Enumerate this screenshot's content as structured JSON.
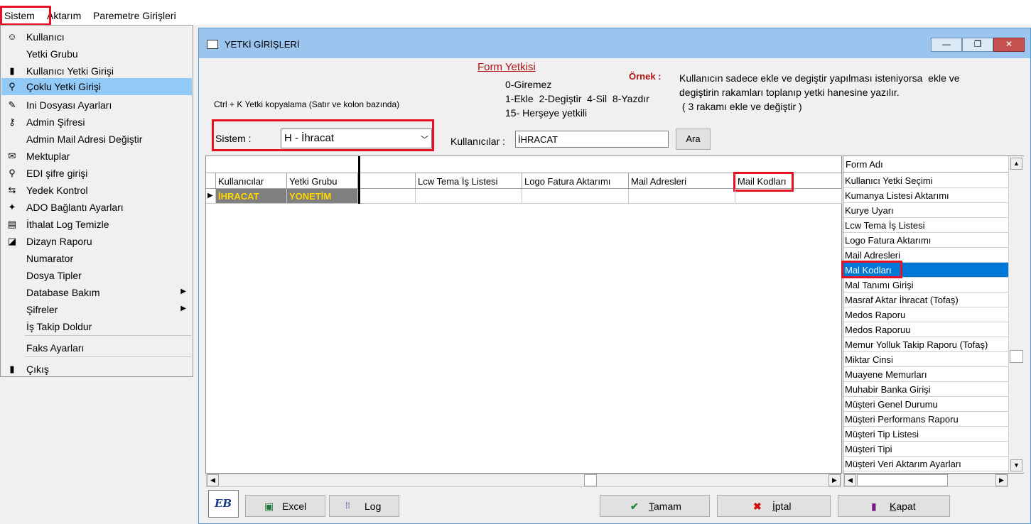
{
  "app": {
    "title_fragment": ""
  },
  "menubar": {
    "items": [
      "Sistem",
      "Aktarım",
      "Paremetre Girişleri"
    ]
  },
  "menu": {
    "items": [
      {
        "label": "Kullanıcı",
        "icon": "user-icon",
        "glyph": "☺"
      },
      {
        "label": "Yetki Grubu",
        "icon": "",
        "glyph": ""
      },
      {
        "label": "Kullanıcı Yetki Girişi",
        "icon": "bottle-icon",
        "glyph": "▮"
      },
      {
        "label": "Çoklu Yetki Girişi",
        "icon": "key-flag-icon",
        "glyph": "⚲"
      },
      {
        "label": "Ini Dosyası  Ayarları",
        "icon": "edit-icon",
        "glyph": "✎"
      },
      {
        "label": "Admin Şifresi",
        "icon": "key-icon",
        "glyph": "⚷"
      },
      {
        "label": "Admin Mail Adresi Değiştir",
        "icon": "",
        "glyph": ""
      },
      {
        "label": "Mektuplar",
        "icon": "letter-icon",
        "glyph": "✉"
      },
      {
        "label": "EDI şifre girişi",
        "icon": "key-flag-icon",
        "glyph": "⚲"
      },
      {
        "label": "Yedek Kontrol",
        "icon": "backup-icon",
        "glyph": "⇆"
      },
      {
        "label": "ADO Bağlantı Ayarları",
        "icon": "connection-icon",
        "glyph": "✦"
      },
      {
        "label": "İthalat Log Temizle",
        "icon": "log-icon",
        "glyph": "▤"
      },
      {
        "label": "Dizayn Raporu",
        "icon": "report-icon",
        "glyph": "◪"
      },
      {
        "label": "Numarator",
        "icon": "",
        "glyph": ""
      },
      {
        "label": "Dosya Tipler",
        "icon": "",
        "glyph": ""
      },
      {
        "label": "Database Bakım",
        "icon": "",
        "glyph": "",
        "submenu": true
      },
      {
        "label": "Şifreler",
        "icon": "",
        "glyph": "",
        "submenu": true
      },
      {
        "label": "İş Takip Doldur",
        "icon": "",
        "glyph": ""
      },
      {
        "label": "Faks Ayarları",
        "icon": "",
        "glyph": ""
      },
      {
        "label": "Çıkış",
        "icon": "exit-icon",
        "glyph": "▮"
      }
    ],
    "selected_index": 3
  },
  "window": {
    "title": "YETKİ GİRİŞLERİ",
    "min": "—",
    "max": "❐",
    "close": "✕"
  },
  "header": {
    "form_yetkisi": "Form Yetkisi",
    "legend_lines": [
      "0-Giremez",
      "1-Ekle  2-Degiştir  4-Sil  8-Yazdır",
      "15- Herşeye yetkili"
    ],
    "ornek_label": "Örnek :",
    "ornek_lines": [
      "Kullanıcın sadece ekle ve degiştir yapılması isteniyorsa  ekle ve",
      "degiştirin rakamları toplanıp yetki hanesine yazılır.",
      " ( 3 rakamı ekle ve değiştir )"
    ],
    "ctrl_hint": "Ctrl + K Yetki kopyalama (Satır ve kolon bazında)",
    "sistem_label": "Sistem :",
    "sistem_value": "H - İhracat",
    "kullanicilar_label": "Kullanıcılar :",
    "kullanicilar_value": "İHRACAT",
    "ara_button": "Ara"
  },
  "grid": {
    "columns": [
      "Kullanıcılar",
      "Yetki Grubu",
      "",
      "Lcw Tema İş Listesi",
      "Logo Fatura Aktarımı",
      "Mail Adresleri",
      "Mail Kodları",
      ""
    ],
    "rows": [
      [
        "İHRACAT",
        "YONETİM",
        "",
        "",
        "",
        "",
        "",
        ""
      ]
    ],
    "row_indicator": "▶"
  },
  "formlist": {
    "header": "Form Adı",
    "items": [
      "Kullanıcı Yetki Seçimi",
      "Kumanya Listesi Aktarımı",
      "Kurye Uyarı",
      "Lcw Tema İş Listesi",
      "Logo Fatura Aktarımı",
      "Mail Adresleri",
      "Mal Kodları",
      "Mal Tanımı Girişi",
      "Masraf Aktar İhracat (Tofaş)",
      "Medos Raporu",
      "Medos Raporuu",
      "Memur Yolluk Takip Raporu (Tofaş)",
      "Miktar Cinsi",
      "Muayene Memurları",
      "Muhabir Banka Girişi",
      "Müşteri Genel Durumu",
      "Müşteri Performans Raporu",
      "Müşteri Tip Listesi",
      "Müşteri Tipi",
      "Müşteri Veri Aktarım Ayarları"
    ],
    "selected_index": 6
  },
  "bottom": {
    "logo_text": "EB",
    "excel": "Excel",
    "log": "Log",
    "tamam": "Tamam",
    "iptal": "İptal",
    "kapat": "Kapat"
  },
  "colors": {
    "highlight": "#e81123",
    "selection": "#0078d7",
    "row_text": "#ffd800",
    "row_bg": "#7f7f7f"
  }
}
